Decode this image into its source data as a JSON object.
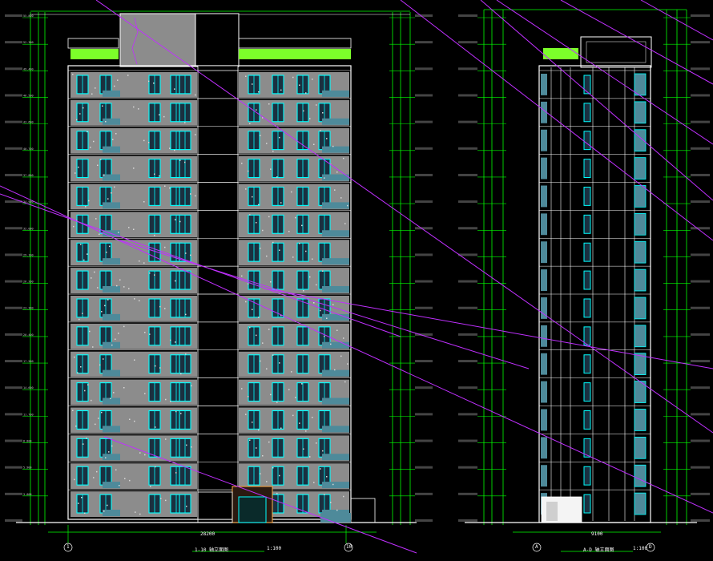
{
  "drawing": {
    "background": "#000000",
    "colors": {
      "outline": "#ffffff",
      "grid": "#00ff00",
      "window": "#00ffff",
      "facade": "#8c8c8c",
      "balcony": "#4e8a9a",
      "roof_green": "#7cff2a",
      "diagonal": "#c030ff",
      "stairwell": "#a0a0a0"
    },
    "views": [
      {
        "name": "front-elevation",
        "floors": 16,
        "title": "1-10 轴立面图",
        "scale": "1:100",
        "axis_left": "1",
        "axis_right": "10",
        "overall_dim": "28200"
      },
      {
        "name": "side-elevation",
        "floors": 16,
        "title": "A-D 轴立面图",
        "scale": "1:100",
        "axis_left": "A",
        "axis_right": "D",
        "overall_dim": "9100"
      }
    ],
    "elevation_labels": [
      "±0.000",
      "3.000",
      "5.900",
      "8.800",
      "11.700",
      "14.600",
      "17.500",
      "20.400",
      "23.300",
      "26.200",
      "29.100",
      "32.000",
      "34.900",
      "37.800",
      "40.700",
      "43.600",
      "46.500",
      "49.400",
      "52.300",
      "55.800"
    ]
  }
}
